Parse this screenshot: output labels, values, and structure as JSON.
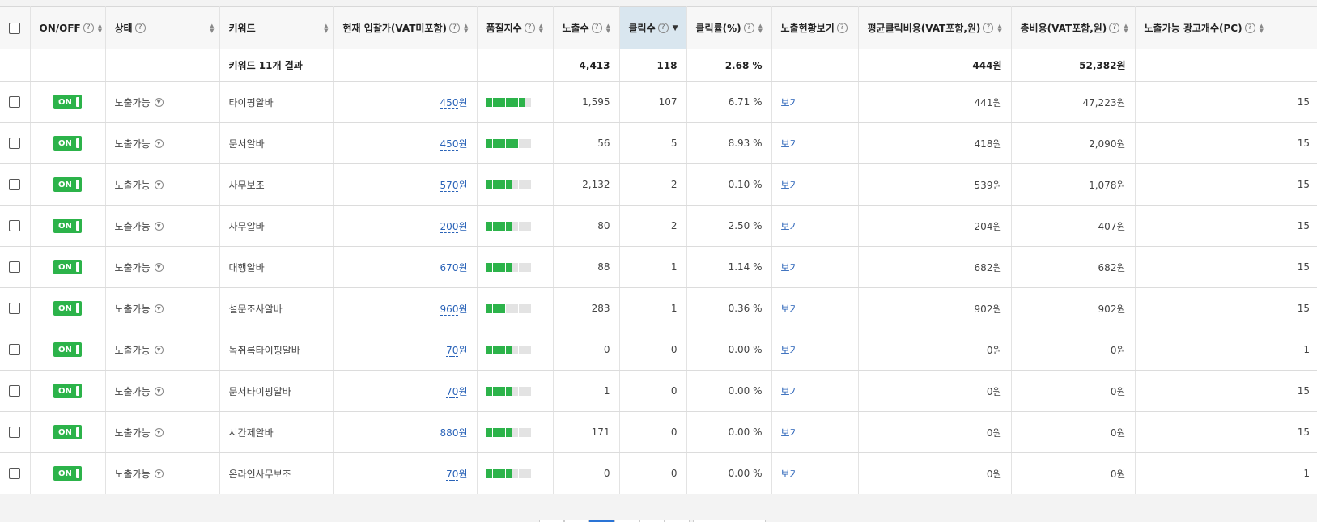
{
  "headers": {
    "onoff": "ON/OFF",
    "status": "상태",
    "keyword": "키워드",
    "bid": "현재 입찰가(VAT미포함)",
    "quality": "품질지수",
    "impressions": "노출수",
    "clicks": "클릭수",
    "ctr": "클릭률(%)",
    "exposure_view": "노출현황보기",
    "avg_cpc": "평균클릭비용(VAT포함,원)",
    "total_cost": "총비용(VAT포함,원)",
    "ad_count": "노출가능 광고개수(PC)"
  },
  "summary": {
    "keyword_result": "키워드 11개 결과",
    "impressions": "4,413",
    "clicks": "118",
    "ctr": "2.68 %",
    "avg_cpc": "444원",
    "total_cost": "52,382원"
  },
  "on_label": "ON",
  "rows": [
    {
      "status": "노출가능",
      "keyword": "타이핑알바",
      "bid": "450",
      "bid_unit": "원",
      "quality": 6,
      "impressions": "1,595",
      "clicks": "107",
      "ctr": "6.71 %",
      "view": "보기",
      "avg_cpc": "441원",
      "total_cost": "47,223원",
      "ad_count": "15"
    },
    {
      "status": "노출가능",
      "keyword": "문서알바",
      "bid": "450",
      "bid_unit": "원",
      "quality": 5,
      "impressions": "56",
      "clicks": "5",
      "ctr": "8.93 %",
      "view": "보기",
      "avg_cpc": "418원",
      "total_cost": "2,090원",
      "ad_count": "15"
    },
    {
      "status": "노출가능",
      "keyword": "사무보조",
      "bid": "570",
      "bid_unit": "원",
      "quality": 4,
      "impressions": "2,132",
      "clicks": "2",
      "ctr": "0.10 %",
      "view": "보기",
      "avg_cpc": "539원",
      "total_cost": "1,078원",
      "ad_count": "15"
    },
    {
      "status": "노출가능",
      "keyword": "사무알바",
      "bid": "200",
      "bid_unit": "원",
      "quality": 4,
      "impressions": "80",
      "clicks": "2",
      "ctr": "2.50 %",
      "view": "보기",
      "avg_cpc": "204원",
      "total_cost": "407원",
      "ad_count": "15"
    },
    {
      "status": "노출가능",
      "keyword": "대행알바",
      "bid": "670",
      "bid_unit": "원",
      "quality": 4,
      "impressions": "88",
      "clicks": "1",
      "ctr": "1.14 %",
      "view": "보기",
      "avg_cpc": "682원",
      "total_cost": "682원",
      "ad_count": "15"
    },
    {
      "status": "노출가능",
      "keyword": "설문조사알바",
      "bid": "960",
      "bid_unit": "원",
      "quality": 3,
      "impressions": "283",
      "clicks": "1",
      "ctr": "0.36 %",
      "view": "보기",
      "avg_cpc": "902원",
      "total_cost": "902원",
      "ad_count": "15"
    },
    {
      "status": "노출가능",
      "keyword": "녹취록타이핑알바",
      "bid": "70",
      "bid_unit": "원",
      "quality": 4,
      "impressions": "0",
      "clicks": "0",
      "ctr": "0.00 %",
      "view": "보기",
      "avg_cpc": "0원",
      "total_cost": "0원",
      "ad_count": "1"
    },
    {
      "status": "노출가능",
      "keyword": "문서타이핑알바",
      "bid": "70",
      "bid_unit": "원",
      "quality": 4,
      "impressions": "1",
      "clicks": "0",
      "ctr": "0.00 %",
      "view": "보기",
      "avg_cpc": "0원",
      "total_cost": "0원",
      "ad_count": "15"
    },
    {
      "status": "노출가능",
      "keyword": "시간제알바",
      "bid": "880",
      "bid_unit": "원",
      "quality": 4,
      "impressions": "171",
      "clicks": "0",
      "ctr": "0.00 %",
      "view": "보기",
      "avg_cpc": "0원",
      "total_cost": "0원",
      "ad_count": "15"
    },
    {
      "status": "노출가능",
      "keyword": "온라인사무보조",
      "bid": "70",
      "bid_unit": "원",
      "quality": 4,
      "impressions": "0",
      "clicks": "0",
      "ctr": "0.00 %",
      "view": "보기",
      "avg_cpc": "0원",
      "total_cost": "0원",
      "ad_count": "1"
    }
  ],
  "quality_max": 7
}
